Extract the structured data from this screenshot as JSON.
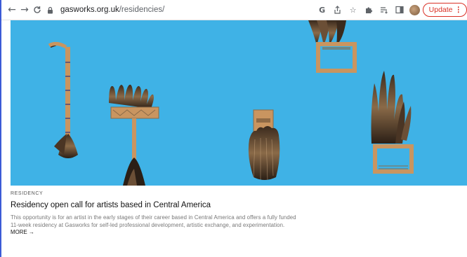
{
  "browser": {
    "url_domain": "gasworks.org.uk",
    "url_path": "/residencies/",
    "update_label": "Update",
    "icons": [
      "back-arrow-icon",
      "forward-arrow-icon",
      "reload-icon",
      "lock-icon",
      "google-icon",
      "share-icon",
      "bookmark-star-icon",
      "extensions-icon",
      "reading-list-icon",
      "side-panel-icon",
      "profile-avatar-icon",
      "more-menu-icon"
    ]
  },
  "article": {
    "category": "RESIDENCY",
    "title": "Residency open call for artists based in Central America",
    "description": "This opportunity is for an artist in the early stages of their career based in Central America and offers a fully funded 11-week residency at Gasworks for self-led professional development, artistic exchange, and experimentation.",
    "more_label": "MORE →"
  },
  "colors": {
    "hero_background": "#3fb2e6",
    "update_accent": "#d93025"
  }
}
